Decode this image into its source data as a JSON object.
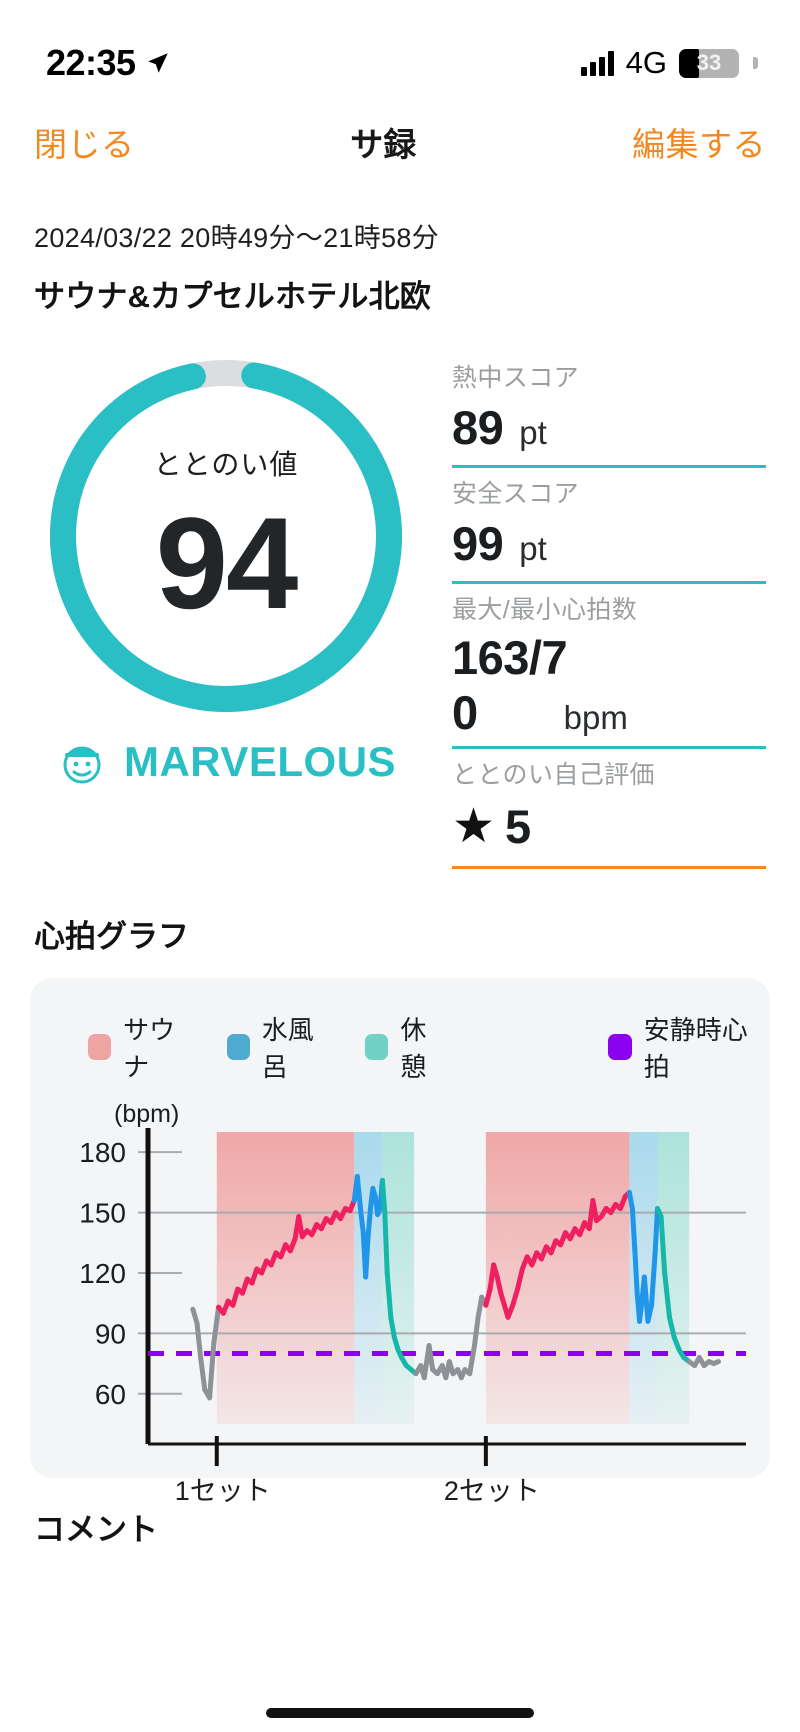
{
  "status_bar": {
    "time": "22:35",
    "location_icon": "location-arrow-icon",
    "signal_icon": "cellular-bars-icon",
    "network": "4G",
    "battery_percent": "33",
    "battery_level": 33
  },
  "nav": {
    "close_label": "閉じる",
    "title": "サ録",
    "edit_label": "編集する"
  },
  "session": {
    "date_range": "2024/03/22 20時49分〜21時58分",
    "venue": "サウナ&カプセルホテル北欧"
  },
  "totonoi": {
    "label": "ととのい値",
    "value": "94",
    "value_number": 94,
    "rank_label": "MARVELOUS",
    "rank_icon": "sauna-hat-character-icon",
    "ring_color": "#29BFC4",
    "ring_track_color": "#dcdddf"
  },
  "stats": [
    {
      "label": "熱中スコア",
      "value": "89",
      "unit": "pt",
      "rule_color": "#29BFC4"
    },
    {
      "label": "安全スコア",
      "value": "99",
      "unit": "pt",
      "rule_color": "#29BFC4"
    },
    {
      "label": "最大/最小心拍数",
      "value_line1": "163/7",
      "value_line2": "0",
      "unit": "bpm",
      "rule_color": "#29BFC4"
    },
    {
      "label": "ととのい自己評価",
      "star": "★",
      "value": "5",
      "rule_color": "#F5871F"
    }
  ],
  "chart_section": {
    "title": "心拍グラフ",
    "legend": [
      {
        "label": "サウナ",
        "color": "#F0A3A3"
      },
      {
        "label": "水風呂",
        "color": "#4FAAD0"
      },
      {
        "label": "休憩",
        "color": "#6FD2C5"
      },
      {
        "label": "安静時心拍",
        "color": "#8A00F0"
      }
    ]
  },
  "footer": {
    "comment_title": "コメント"
  },
  "chart_data": {
    "type": "line",
    "title": "心拍グラフ",
    "ylabel": "(bpm)",
    "xlabel": "",
    "ylim": [
      45,
      192
    ],
    "yticks": [
      180,
      150,
      120,
      90,
      60
    ],
    "ytick_labels": [
      "180",
      "150",
      "120",
      "90",
      "60"
    ],
    "gridlines": [
      150,
      90
    ],
    "grid": true,
    "xticks": [
      0.115,
      0.565
    ],
    "xtick_labels": [
      "1セット",
      "2セット"
    ],
    "resting_hr": {
      "value": 80,
      "label": "安静時心拍",
      "color": "#8A00F0",
      "style": "dashed"
    },
    "phases": [
      {
        "name": "サウナ",
        "type": "sauna",
        "x0": 0.115,
        "x1": 0.345,
        "color": "#F0A3A3"
      },
      {
        "name": "水風呂",
        "type": "cold",
        "x0": 0.345,
        "x1": 0.392,
        "color": "#4FAAD0"
      },
      {
        "name": "休憩",
        "type": "rest",
        "x0": 0.392,
        "x1": 0.445,
        "color": "#6FD2C5"
      },
      {
        "name": "サウナ",
        "type": "sauna",
        "x0": 0.565,
        "x1": 0.805,
        "color": "#F0A3A3"
      },
      {
        "name": "水風呂",
        "type": "cold",
        "x0": 0.805,
        "x1": 0.852,
        "color": "#4FAAD0"
      },
      {
        "name": "休憩",
        "type": "rest",
        "x0": 0.852,
        "x1": 0.905,
        "color": "#6FD2C5"
      }
    ],
    "series": [
      {
        "name": "心拍数",
        "unit": "bpm",
        "colors": {
          "sauna": "#EE2060",
          "cold": "#2196E8",
          "rest": "#16B6A8",
          "idle": "#8E9296"
        },
        "points": [
          [
            0.075,
            102
          ],
          [
            0.082,
            95
          ],
          [
            0.088,
            78
          ],
          [
            0.095,
            62
          ],
          [
            0.103,
            58
          ],
          [
            0.11,
            85
          ],
          [
            0.118,
            103
          ],
          [
            0.126,
            100
          ],
          [
            0.134,
            106
          ],
          [
            0.142,
            104
          ],
          [
            0.15,
            112
          ],
          [
            0.158,
            110
          ],
          [
            0.166,
            117
          ],
          [
            0.174,
            115
          ],
          [
            0.182,
            122
          ],
          [
            0.19,
            120
          ],
          [
            0.198,
            126
          ],
          [
            0.206,
            124
          ],
          [
            0.214,
            130
          ],
          [
            0.222,
            128
          ],
          [
            0.23,
            134
          ],
          [
            0.238,
            131
          ],
          [
            0.246,
            137
          ],
          [
            0.252,
            148
          ],
          [
            0.258,
            138
          ],
          [
            0.266,
            141
          ],
          [
            0.274,
            139
          ],
          [
            0.282,
            144
          ],
          [
            0.29,
            142
          ],
          [
            0.298,
            147
          ],
          [
            0.306,
            145
          ],
          [
            0.314,
            150
          ],
          [
            0.322,
            147
          ],
          [
            0.33,
            152
          ],
          [
            0.338,
            151
          ],
          [
            0.345,
            156
          ],
          [
            0.35,
            168
          ],
          [
            0.356,
            150
          ],
          [
            0.36,
            140
          ],
          [
            0.364,
            118
          ],
          [
            0.368,
            138
          ],
          [
            0.372,
            152
          ],
          [
            0.376,
            162
          ],
          [
            0.38,
            158
          ],
          [
            0.384,
            149
          ],
          [
            0.388,
            152
          ],
          [
            0.392,
            166
          ],
          [
            0.396,
            150
          ],
          [
            0.4,
            120
          ],
          [
            0.406,
            98
          ],
          [
            0.412,
            88
          ],
          [
            0.418,
            82
          ],
          [
            0.424,
            78
          ],
          [
            0.432,
            74
          ],
          [
            0.44,
            72
          ],
          [
            0.448,
            70
          ],
          [
            0.456,
            74
          ],
          [
            0.462,
            68
          ],
          [
            0.47,
            84
          ],
          [
            0.476,
            72
          ],
          [
            0.484,
            70
          ],
          [
            0.492,
            74
          ],
          [
            0.498,
            68
          ],
          [
            0.504,
            76
          ],
          [
            0.51,
            70
          ],
          [
            0.518,
            72
          ],
          [
            0.524,
            68
          ],
          [
            0.53,
            72
          ],
          [
            0.538,
            70
          ],
          [
            0.546,
            84
          ],
          [
            0.552,
            98
          ],
          [
            0.558,
            108
          ],
          [
            0.565,
            104
          ],
          [
            0.572,
            112
          ],
          [
            0.578,
            124
          ],
          [
            0.584,
            118
          ],
          [
            0.59,
            110
          ],
          [
            0.596,
            104
          ],
          [
            0.602,
            98
          ],
          [
            0.61,
            104
          ],
          [
            0.618,
            112
          ],
          [
            0.626,
            122
          ],
          [
            0.634,
            128
          ],
          [
            0.642,
            124
          ],
          [
            0.65,
            130
          ],
          [
            0.658,
            127
          ],
          [
            0.666,
            133
          ],
          [
            0.674,
            130
          ],
          [
            0.682,
            136
          ],
          [
            0.69,
            134
          ],
          [
            0.698,
            140
          ],
          [
            0.706,
            137
          ],
          [
            0.714,
            142
          ],
          [
            0.722,
            139
          ],
          [
            0.73,
            145
          ],
          [
            0.738,
            142
          ],
          [
            0.744,
            156
          ],
          [
            0.75,
            146
          ],
          [
            0.758,
            148
          ],
          [
            0.766,
            152
          ],
          [
            0.774,
            150
          ],
          [
            0.782,
            154
          ],
          [
            0.79,
            152
          ],
          [
            0.798,
            158
          ],
          [
            0.805,
            160
          ],
          [
            0.81,
            152
          ],
          [
            0.814,
            132
          ],
          [
            0.818,
            110
          ],
          [
            0.822,
            96
          ],
          [
            0.826,
            106
          ],
          [
            0.83,
            118
          ],
          [
            0.836,
            96
          ],
          [
            0.842,
            104
          ],
          [
            0.848,
            130
          ],
          [
            0.852,
            152
          ],
          [
            0.858,
            148
          ],
          [
            0.864,
            120
          ],
          [
            0.872,
            98
          ],
          [
            0.88,
            88
          ],
          [
            0.888,
            82
          ],
          [
            0.896,
            78
          ],
          [
            0.905,
            76
          ],
          [
            0.914,
            74
          ],
          [
            0.922,
            78
          ],
          [
            0.93,
            74
          ],
          [
            0.938,
            76
          ],
          [
            0.946,
            75
          ],
          [
            0.954,
            76
          ]
        ]
      }
    ]
  }
}
